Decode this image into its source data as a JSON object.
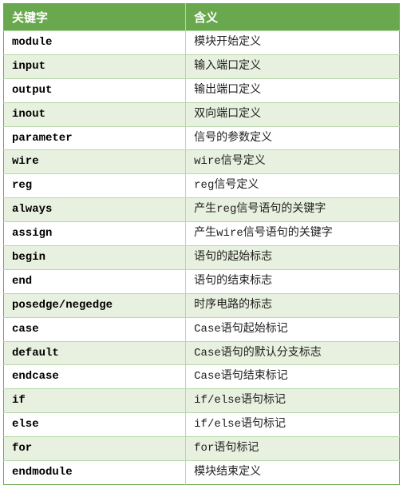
{
  "headers": {
    "col1": "关键字",
    "col2": "含义"
  },
  "rows": [
    {
      "keyword": "module",
      "meaning": "模块开始定义"
    },
    {
      "keyword": "input",
      "meaning": "输入端口定义"
    },
    {
      "keyword": "output",
      "meaning": "输出端口定义"
    },
    {
      "keyword": "inout",
      "meaning": "双向端口定义"
    },
    {
      "keyword": "parameter",
      "meaning": "信号的参数定义"
    },
    {
      "keyword": "wire",
      "meaning": "wire信号定义"
    },
    {
      "keyword": "reg",
      "meaning": "reg信号定义"
    },
    {
      "keyword": "always",
      "meaning": "产生reg信号语句的关键字"
    },
    {
      "keyword": "assign",
      "meaning": "产生wire信号语句的关键字"
    },
    {
      "keyword": "begin",
      "meaning": "语句的起始标志"
    },
    {
      "keyword": "end",
      "meaning": "语句的结束标志"
    },
    {
      "keyword": "posedge/negedge",
      "meaning": "时序电路的标志"
    },
    {
      "keyword": "case",
      "meaning": "Case语句起始标记"
    },
    {
      "keyword": "default",
      "meaning": "Case语句的默认分支标志"
    },
    {
      "keyword": "endcase",
      "meaning": "Case语句结束标记"
    },
    {
      "keyword": "if",
      "meaning": "if/else语句标记"
    },
    {
      "keyword": "else",
      "meaning": "if/else语句标记"
    },
    {
      "keyword": "for",
      "meaning": "for语句标记"
    },
    {
      "keyword": "endmodule",
      "meaning": "模块结束定义"
    }
  ],
  "chart_data": {
    "type": "table",
    "title": "",
    "columns": [
      "关键字",
      "含义"
    ],
    "rows": [
      [
        "module",
        "模块开始定义"
      ],
      [
        "input",
        "输入端口定义"
      ],
      [
        "output",
        "输出端口定义"
      ],
      [
        "inout",
        "双向端口定义"
      ],
      [
        "parameter",
        "信号的参数定义"
      ],
      [
        "wire",
        "wire信号定义"
      ],
      [
        "reg",
        "reg信号定义"
      ],
      [
        "always",
        "产生reg信号语句的关键字"
      ],
      [
        "assign",
        "产生wire信号语句的关键字"
      ],
      [
        "begin",
        "语句的起始标志"
      ],
      [
        "end",
        "语句的结束标志"
      ],
      [
        "posedge/negedge",
        "时序电路的标志"
      ],
      [
        "case",
        "Case语句起始标记"
      ],
      [
        "default",
        "Case语句的默认分支标志"
      ],
      [
        "endcase",
        "Case语句结束标记"
      ],
      [
        "if",
        "if/else语句标记"
      ],
      [
        "else",
        "if/else语句标记"
      ],
      [
        "for",
        "for语句标记"
      ],
      [
        "endmodule",
        "模块结束定义"
      ]
    ]
  }
}
